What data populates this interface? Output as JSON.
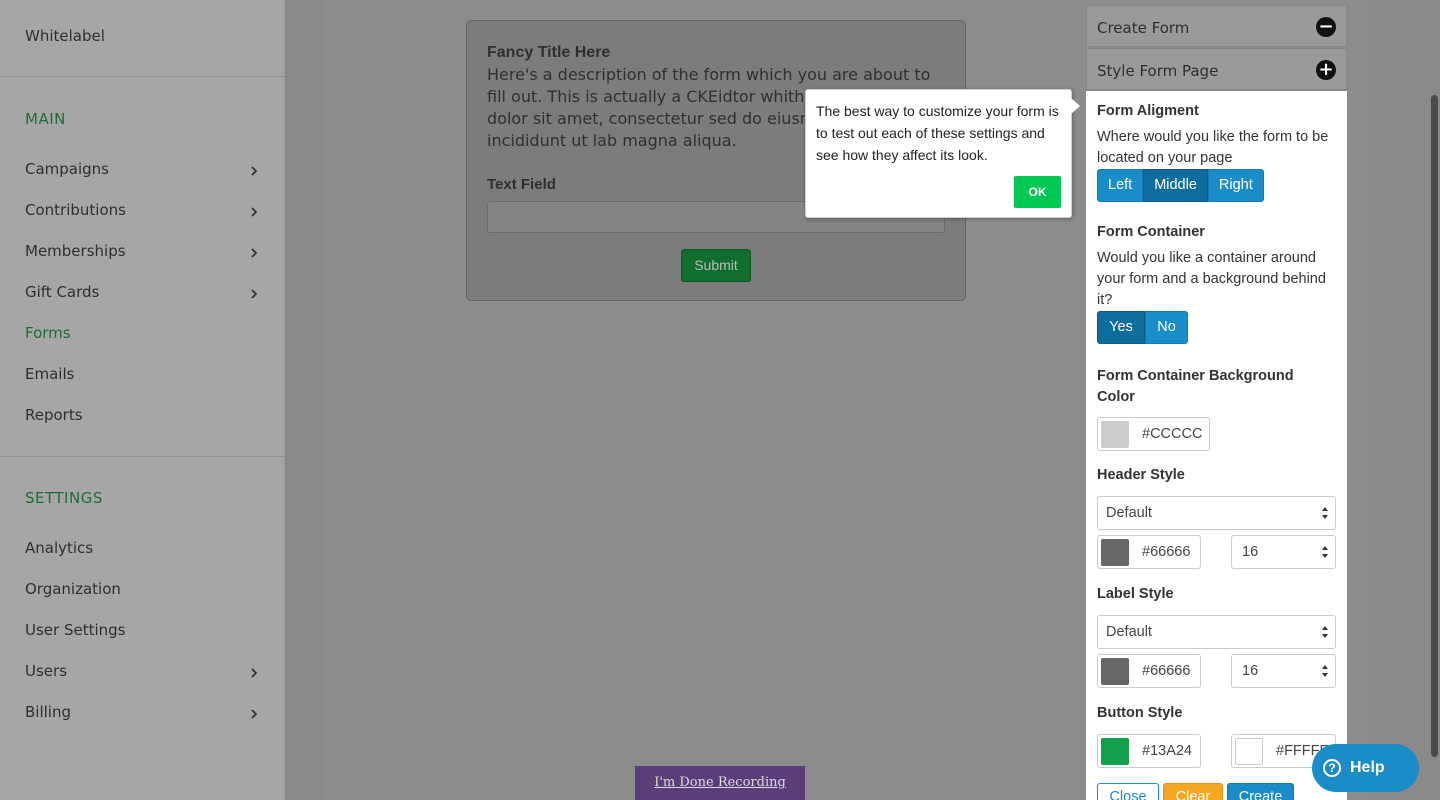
{
  "sidebar": {
    "top_item": "Whitelabel",
    "main_section": "MAIN",
    "main_items": [
      {
        "label": "Campaigns",
        "has_children": true
      },
      {
        "label": "Contributions",
        "has_children": true
      },
      {
        "label": "Memberships",
        "has_children": true
      },
      {
        "label": "Gift Cards",
        "has_children": true
      },
      {
        "label": "Forms",
        "has_children": false,
        "active": true
      },
      {
        "label": "Emails",
        "has_children": false
      },
      {
        "label": "Reports",
        "has_children": false
      }
    ],
    "settings_section": "SETTINGS",
    "settings_items": [
      {
        "label": "Analytics",
        "has_children": false
      },
      {
        "label": "Organization",
        "has_children": false
      },
      {
        "label": "User Settings",
        "has_children": false
      },
      {
        "label": "Users",
        "has_children": true
      },
      {
        "label": "Billing",
        "has_children": true
      }
    ]
  },
  "form_preview": {
    "title": "Fancy Title Here",
    "description": "Here's a description of the form which you are about to fill out. This is actually a CKEidtor whith Lorem ipsum dolor sit amet, consectetur sed do eiusmod tempor incididunt ut lab magna aliqua.",
    "field_label": "Text Field",
    "submit_label": "Submit"
  },
  "tooltip": {
    "text": "The best way to customize your form is to test out each of these settings and see how they affect its look.",
    "ok_label": "OK"
  },
  "panel": {
    "create_form": {
      "label": "Create Form",
      "icon": "minus-circle-icon"
    },
    "style_form_page": {
      "label": "Style Form Page",
      "icon": "plus-circle-icon"
    },
    "form_alignment": {
      "title": "Form Aligment",
      "text": "Where would you like the form to be located on your page",
      "options": [
        "Left",
        "Middle",
        "Right"
      ],
      "selected": "Middle"
    },
    "form_container": {
      "title": "Form Container",
      "text": "Would you like a container around your form and a background behind it?",
      "options": [
        "Yes",
        "No"
      ],
      "selected": "Yes"
    },
    "container_bg": {
      "title": "Form Container Background Color",
      "value": "#CCCCC",
      "swatch": "#cccccc"
    },
    "header_style": {
      "title": "Header Style",
      "font": "Default",
      "color_value": "#66666",
      "swatch": "#666666",
      "size": "16"
    },
    "label_style": {
      "title": "Label Style",
      "font": "Default",
      "color_value": "#66666",
      "swatch": "#666666",
      "size": "16"
    },
    "button_style": {
      "title": "Button Style",
      "bg_value": "#13A24",
      "bg_swatch": "#13a24b",
      "text_value": "#FFFFF",
      "text_swatch": "#ffffff"
    },
    "actions": {
      "close": "Close",
      "clear": "Clear",
      "create": "Create"
    }
  },
  "help": {
    "label": "Help",
    "icon": "question-circle-icon"
  },
  "recording": {
    "label": "I'm Done Recording"
  },
  "colors": {
    "accent": "#1a8dc8",
    "accent_selected": "#0f6d9e",
    "ok_green": "#00c853",
    "clear_orange": "#f5a623",
    "recording_purple": "#5a3e7a"
  }
}
